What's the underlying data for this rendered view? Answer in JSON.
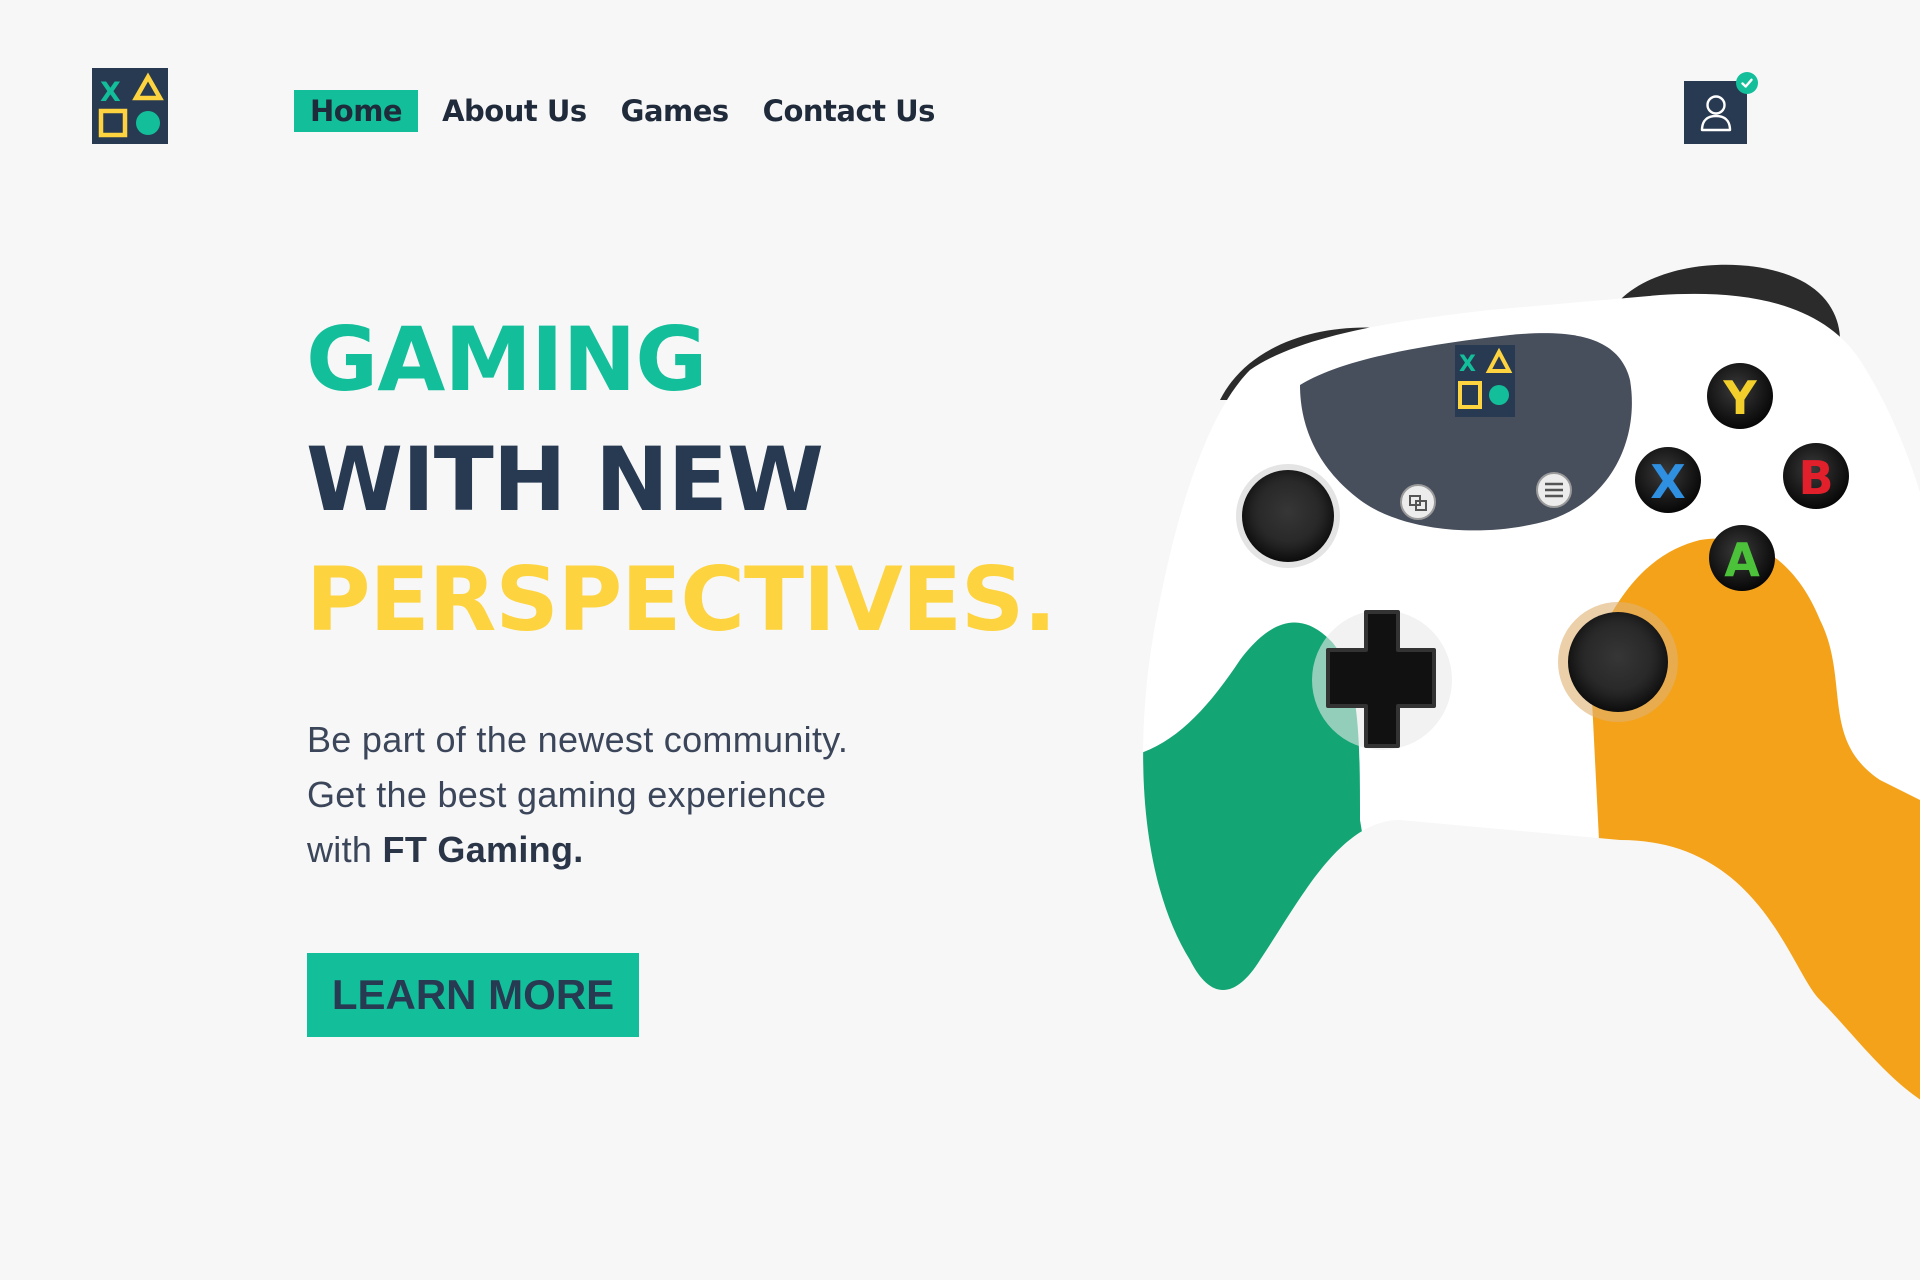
{
  "brand": {
    "logo_glyph": "X"
  },
  "nav": {
    "items": [
      {
        "label": "Home",
        "active": true
      },
      {
        "label": "About Us",
        "active": false
      },
      {
        "label": "Games",
        "active": false
      },
      {
        "label": "Contact Us",
        "active": false
      }
    ]
  },
  "user": {
    "icon": "user-icon",
    "badge_icon": "check-icon"
  },
  "hero": {
    "line1": "GAMING",
    "line2": "WITH NEW",
    "line3": "PERSPECTIVES.",
    "desc_line1": "Be part of the newest community.",
    "desc_line2": "Get the best gaming experience",
    "desc_line3_prefix": "with ",
    "desc_brand": "FT Gaming.",
    "cta_label": "LEARN MORE"
  },
  "controller": {
    "screen_glyph": "X",
    "button_y": "Y",
    "button_x": "X",
    "button_b": "B",
    "button_a": "A"
  },
  "colors": {
    "accent_teal": "#13bf9a",
    "navy": "#283a52",
    "yellow": "#fdd33f",
    "orange": "#f4a21a",
    "green": "#13a574",
    "background": "#f7f7f7"
  }
}
